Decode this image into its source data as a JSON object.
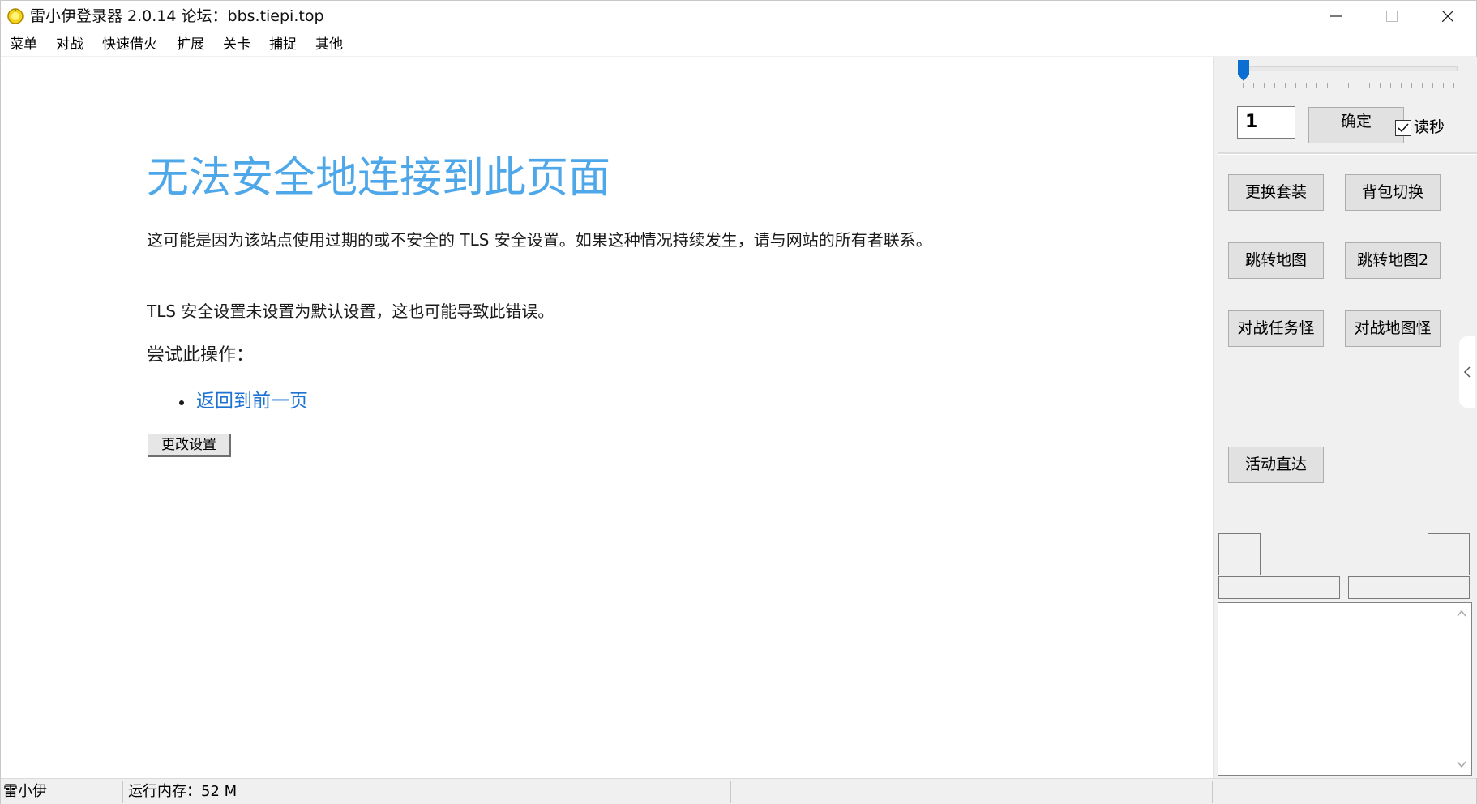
{
  "window": {
    "title": "雷小伊登录器 2.0.14  论坛：bbs.tiepi.top",
    "icon": "lemon-icon"
  },
  "menu": [
    "菜单",
    "对战",
    "快速借火",
    "扩展",
    "关卡",
    "捕捉",
    "其他"
  ],
  "browser": {
    "error_title": "无法安全地连接到此页面",
    "paragraph1": "这可能是因为该站点使用过期的或不安全的 TLS 安全设置。如果这种情况持续发生，请与网站的所有者联系。",
    "paragraph2": "TLS 安全设置未设置为默认设置，这也可能导致此错误。",
    "try_heading": "尝试此操作：",
    "back_link": "返回到前一页",
    "settings_button": "更改设置"
  },
  "panel": {
    "slider_value": 0,
    "input_value": "1",
    "confirm_button": "确定",
    "read_seconds_label": "读秒",
    "read_seconds_checked": true,
    "buttons": {
      "change_outfit": "更换套装",
      "bag_switch": "背包切换",
      "jump_map": "跳转地图",
      "jump_map2": "跳转地图2",
      "battle_task_monster": "对战任务怪",
      "battle_map_monster": "对战地图怪",
      "activity_direct": "活动直达"
    }
  },
  "status": {
    "user": "雷小伊",
    "memory": "运行内存：52 M"
  },
  "colors": {
    "error_title": "#4ea7e9",
    "link": "#1e73d2",
    "slider_thumb": "#0a6fd1",
    "panel_bg": "#f0f0f0"
  }
}
